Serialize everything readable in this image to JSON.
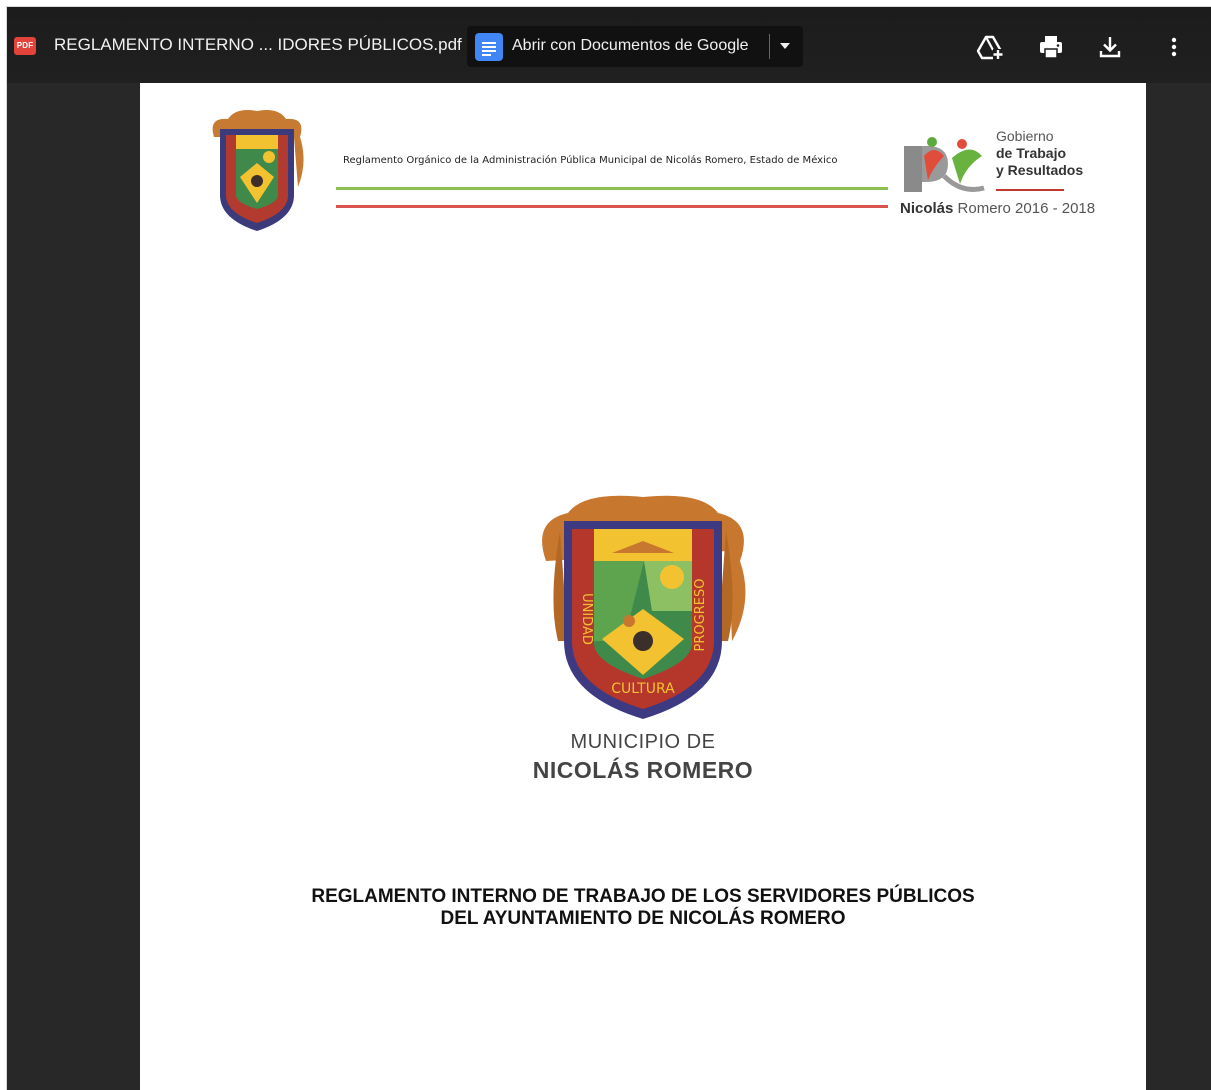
{
  "toolbar": {
    "file_badge": "PDF",
    "file_name": "REGLAMENTO INTERNO ... IDORES PÚBLICOS.pdf",
    "open_with_label": "Abrir con Documentos de Google",
    "icons": [
      "pdf-file-icon",
      "google-docs-icon",
      "chevron-down-icon",
      "add-to-drive-icon",
      "print-icon",
      "download-icon",
      "more-vert-icon"
    ]
  },
  "document": {
    "header_text": "Reglamento Orgánico de la Administración Pública Municipal de Nicolás Romero, Estado de México",
    "crest_banner": "UNIDAD",
    "crest_side": "PROGRESO",
    "crest_bottom": "CULTURA",
    "gobierno_line1": "Gobierno",
    "gobierno_line2": "de Trabajo",
    "gobierno_line3": "y Resultados",
    "nicolas_bold": "Nicolás",
    "nicolas_rest": " Romero 2016 - 2018",
    "municipio_de": "MUNICIPIO DE",
    "municipio_name": "NICOLÁS ROMERO",
    "title_line1": "REGLAMENTO INTERNO DE TRABAJO DE LOS SERVIDORES PÚBLICOS",
    "title_line2": "DEL AYUNTAMIENTO DE NICOLÁS ROMERO"
  },
  "colors": {
    "viewer_bg": "#282828",
    "toolbar_bg": "#1c1c1c",
    "pdf_badge": "#e2433a",
    "docs_blue": "#4285f4",
    "header_green": "#8cc152",
    "header_red": "#d9534f"
  }
}
